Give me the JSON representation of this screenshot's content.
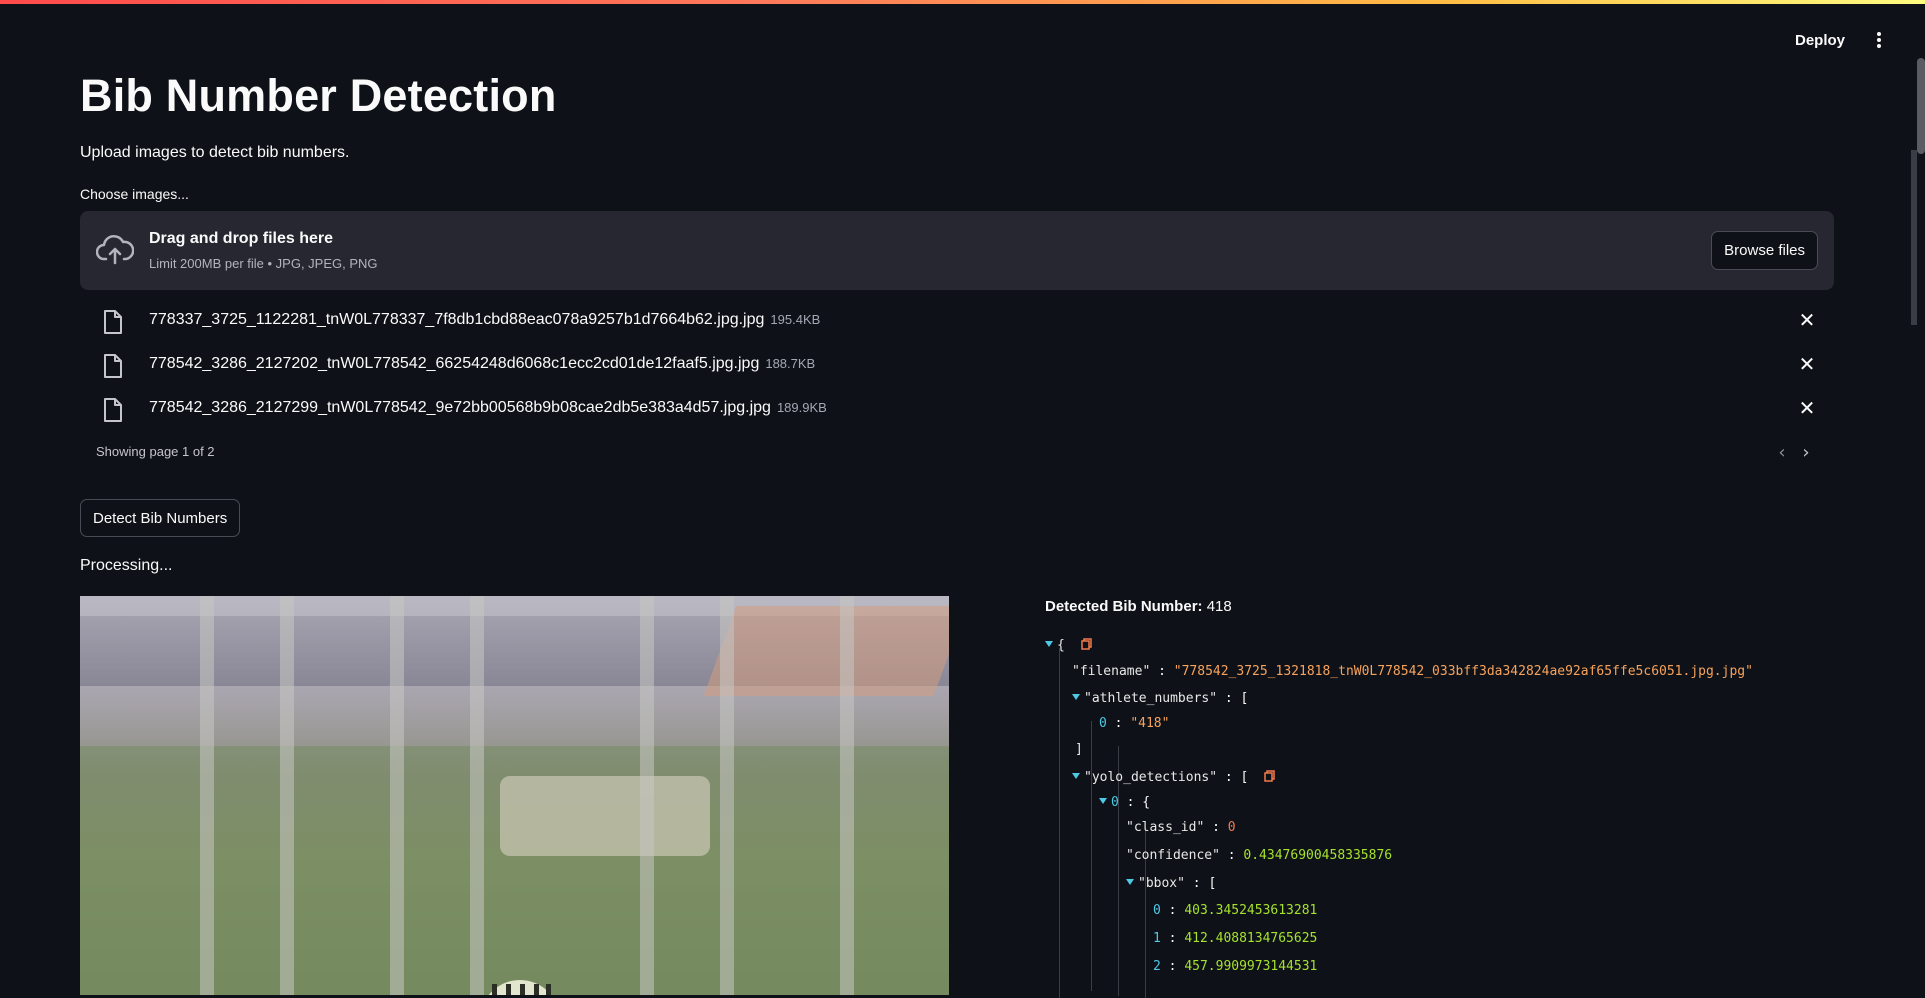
{
  "header": {
    "deploy_label": "Deploy"
  },
  "main": {
    "title": "Bib Number Detection",
    "subtitle": "Upload images to detect bib numbers.",
    "uploader_label": "Choose images...",
    "dropzone": {
      "title": "Drag and drop files here",
      "limit": "Limit 200MB per file • JPG, JPEG, PNG",
      "browse_label": "Browse files"
    },
    "files": [
      {
        "name": "778337_3725_1122281_tnW0L778337_7f8db1cbd88eac078a9257b1d7664b62.jpg.jpg",
        "size": "195.4KB"
      },
      {
        "name": "778542_3286_2127202_tnW0L778542_66254248d6068c1ecc2cd01de12faaf5.jpg.jpg",
        "size": "188.7KB"
      },
      {
        "name": "778542_3286_2127299_tnW0L778542_9e72bb00568b9b08cae2db5e383a4d57.jpg.jpg",
        "size": "189.9KB"
      }
    ],
    "pagination": "Showing page 1 of 2",
    "detect_label": "Detect Bib Numbers",
    "status": "Processing..."
  },
  "result": {
    "title_label": "Detected Bib Number:",
    "bib_number": "418",
    "json": {
      "open_brace": "{",
      "filename_key": "\"filename\"",
      "filename_value": "\"778542_3725_1321818_tnW0L778542_033bff3da342824ae92af65ffe5c6051.jpg.jpg\"",
      "athlete_numbers_key": "\"athlete_numbers\"",
      "athlete_index": "0",
      "athlete_value": "\"418\"",
      "close_bracket": "]",
      "yolo_key": "\"yolo_detections\"",
      "det_index": "0",
      "class_id_key": "\"class_id\"",
      "class_id_value": "0",
      "confidence_key": "\"confidence\"",
      "confidence_value": "0.43476900458335876",
      "bbox_key": "\"bbox\"",
      "bbox": [
        {
          "index": "0",
          "value": "403.3452453613281"
        },
        {
          "index": "1",
          "value": "412.4088134765625"
        },
        {
          "index": "2",
          "value": "457.9909973144531"
        }
      ]
    }
  },
  "colors": {
    "background": "#0e1117",
    "dropzone": "#262730",
    "json_string": "#f7a35c",
    "json_number": "#a6e22e",
    "json_index": "#4ec9e6"
  }
}
